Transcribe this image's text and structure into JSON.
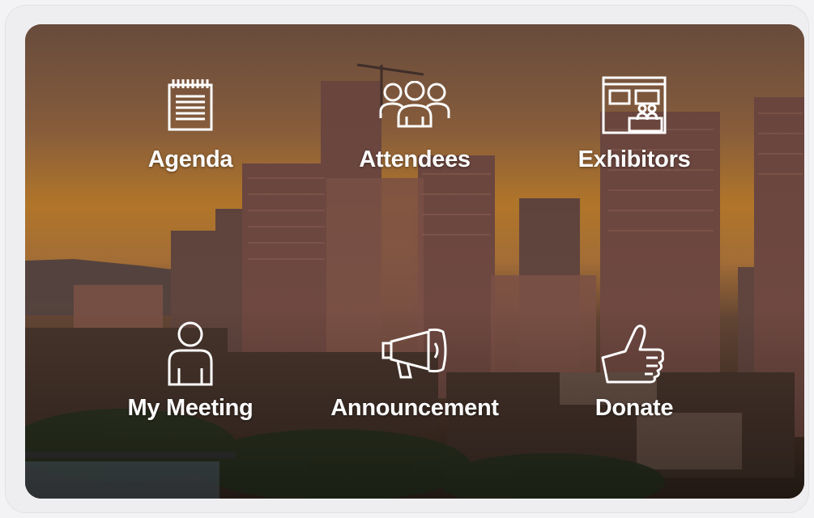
{
  "menu": {
    "items": [
      {
        "label": "Agenda",
        "icon": "notepad-icon"
      },
      {
        "label": "Attendees",
        "icon": "people-group-icon"
      },
      {
        "label": "Exhibitors",
        "icon": "exhibit-booth-icon"
      },
      {
        "label": "My Meeting",
        "icon": "person-icon"
      },
      {
        "label": "Announcement",
        "icon": "megaphone-icon"
      },
      {
        "label": "Donate",
        "icon": "thumbs-up-icon"
      }
    ]
  },
  "colors": {
    "label_text": "#ffffff",
    "sky_top": "#8a5a3e",
    "sky_glow": "#e39a3c",
    "frame": "#eeeef1"
  }
}
